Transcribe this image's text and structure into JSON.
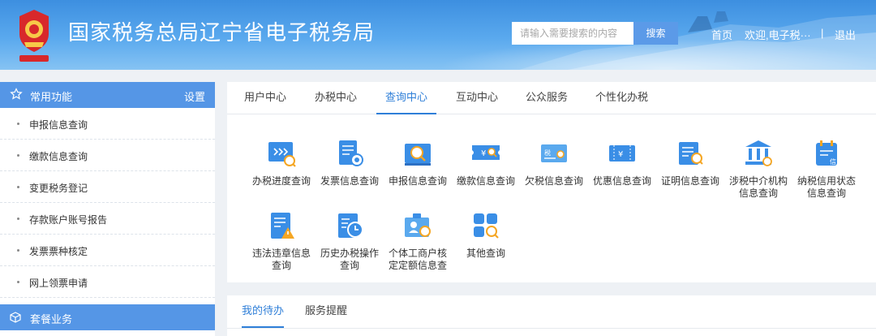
{
  "header": {
    "title": "国家税务总局辽宁省电子税务局",
    "search_placeholder": "请输入需要搜索的内容",
    "search_button": "搜索",
    "home": "首页",
    "welcome": "欢迎,电子税···",
    "separator": "|",
    "logout": "退出"
  },
  "sidebar": {
    "section_title": "常用功能",
    "settings": "设置",
    "items": [
      {
        "label": "申报信息查询"
      },
      {
        "label": "缴款信息查询"
      },
      {
        "label": "变更税务登记"
      },
      {
        "label": "存款账户账号报告"
      },
      {
        "label": "发票票种核定"
      },
      {
        "label": "网上领票申请"
      }
    ],
    "section2_title": "套餐业务"
  },
  "tabs": [
    {
      "label": "用户中心"
    },
    {
      "label": "办税中心"
    },
    {
      "label": "查询中心",
      "active": true
    },
    {
      "label": "互动中心"
    },
    {
      "label": "公众服务"
    },
    {
      "label": "个性化办税"
    }
  ],
  "query_items": [
    {
      "label": "办税进度查询",
      "icon": "progress-query-icon"
    },
    {
      "label": "发票信息查询",
      "icon": "invoice-query-icon"
    },
    {
      "label": "申报信息查询",
      "icon": "declaration-query-icon"
    },
    {
      "label": "缴款信息查询",
      "icon": "payment-query-icon"
    },
    {
      "label": "欠税信息查询",
      "icon": "arrears-query-icon"
    },
    {
      "label": "优惠信息查询",
      "icon": "preferential-query-icon"
    },
    {
      "label": "证明信息查询",
      "icon": "certificate-query-icon"
    },
    {
      "label_line1": "涉税中介机构",
      "label_line2": "信息查询",
      "icon": "agency-query-icon"
    },
    {
      "label_line1": "纳税信用状态",
      "label_line2": "信息查询",
      "icon": "credit-query-icon"
    },
    {
      "label_line1": "违法违章信息",
      "label_line2": "查询",
      "icon": "violation-query-icon"
    },
    {
      "label_line1": "历史办税操作",
      "label_line2": "查询",
      "icon": "history-query-icon"
    },
    {
      "label_line1": "个体工商户核",
      "label_line2": "定定额信息查",
      "icon": "individual-business-query-icon"
    },
    {
      "label": "其他查询",
      "icon": "other-query-icon"
    }
  ],
  "bottom_tabs": [
    {
      "label": "我的待办",
      "active": true
    },
    {
      "label": "服务提醒"
    }
  ],
  "colors": {
    "accent": "#2f7fd8",
    "sidebar_header": "#5596e6",
    "icon_blue": "#3a8ee6",
    "icon_orange": "#f5a623"
  }
}
